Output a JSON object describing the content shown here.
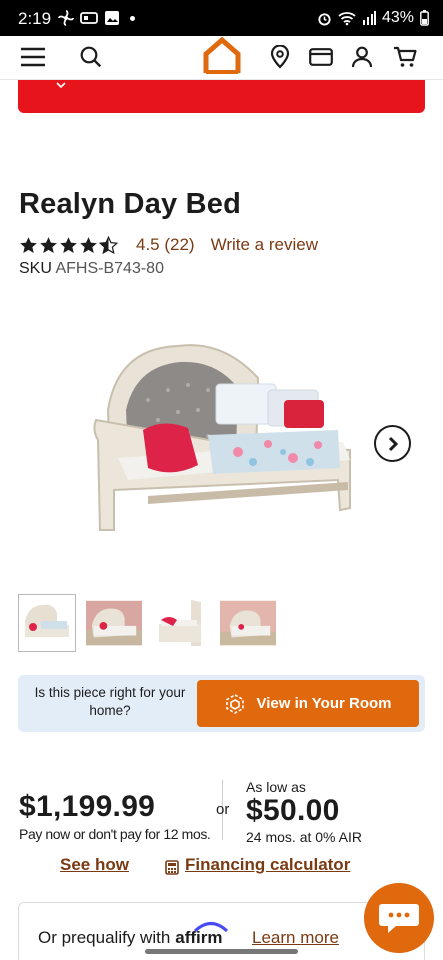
{
  "status_bar": {
    "time": "2:19",
    "battery": "43%"
  },
  "product": {
    "title": "Realyn Day Bed",
    "rating_value": 4.5,
    "rating_text": "4.5 (22)",
    "write_review": "Write a review",
    "sku_label": "SKU",
    "sku_value": "AFHS-B743-80"
  },
  "room_bar": {
    "question": "Is this piece right for your home?",
    "button_label": "View in Your Room"
  },
  "pricing": {
    "price": "$1,199.99",
    "price_note": "Pay now or don't pay for 12 mos.",
    "or": "or",
    "as_low_as": "As low as",
    "monthly": "$50.00",
    "term": "24 mos. at 0% AIR"
  },
  "links": {
    "see_how": "See how",
    "financing": "Financing calculator"
  },
  "affirm": {
    "prequalify": "Or prequalify with",
    "brand": "affirm",
    "learn_more": "Learn more"
  },
  "colors": {
    "brand_orange": "#e0690e",
    "banner_red": "#e8141c",
    "link_brown": "#7a3b14",
    "room_bar_bg": "#e3edf7"
  },
  "icons": {
    "nav": [
      "menu-icon",
      "search-icon",
      "home-logo-icon",
      "location-icon",
      "card-icon",
      "account-icon",
      "cart-icon"
    ],
    "chat": "chat-icon"
  }
}
